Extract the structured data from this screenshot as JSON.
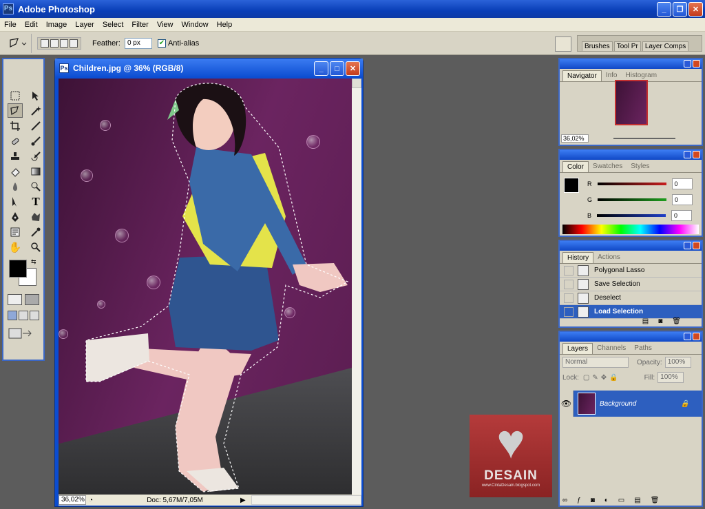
{
  "app": {
    "title": "Adobe Photoshop"
  },
  "menu": [
    "File",
    "Edit",
    "Image",
    "Layer",
    "Select",
    "Filter",
    "View",
    "Window",
    "Help"
  ],
  "options": {
    "feather_label": "Feather:",
    "feather_value": "0 px",
    "antialias_label": "Anti-alias",
    "antialias_checked": true
  },
  "palette_well": [
    "Brushes",
    "Tool Pr",
    "Layer Comps"
  ],
  "document": {
    "title": "Children.jpg @ 36% (RGB/8)",
    "zoom": "36,02%",
    "doc_info": "Doc: 5,67M/7,05M"
  },
  "navigator": {
    "tabs": [
      "Navigator",
      "Info",
      "Histogram"
    ],
    "zoom": "36,02%"
  },
  "color": {
    "tabs": [
      "Color",
      "Swatches",
      "Styles"
    ],
    "channels": [
      {
        "label": "R",
        "value": "0",
        "color": "#c81e1e"
      },
      {
        "label": "G",
        "value": "0",
        "color": "#1e9e1e"
      },
      {
        "label": "B",
        "value": "0",
        "color": "#1e3ec8"
      }
    ]
  },
  "history": {
    "tabs": [
      "History",
      "Actions"
    ],
    "items": [
      {
        "label": "Polygonal Lasso"
      },
      {
        "label": "Save Selection"
      },
      {
        "label": "Deselect"
      },
      {
        "label": "Load Selection",
        "active": true
      }
    ]
  },
  "layers": {
    "tabs": [
      "Layers",
      "Channels",
      "Paths"
    ],
    "blend_mode": "Normal",
    "opacity_label": "Opacity:",
    "opacity": "100%",
    "lock_label": "Lock:",
    "fill_label": "Fill:",
    "fill": "100%",
    "layer_name": "Background"
  },
  "watermark": {
    "word": "DESAIN",
    "url": "www.CintaDesain.blogspot.com"
  }
}
